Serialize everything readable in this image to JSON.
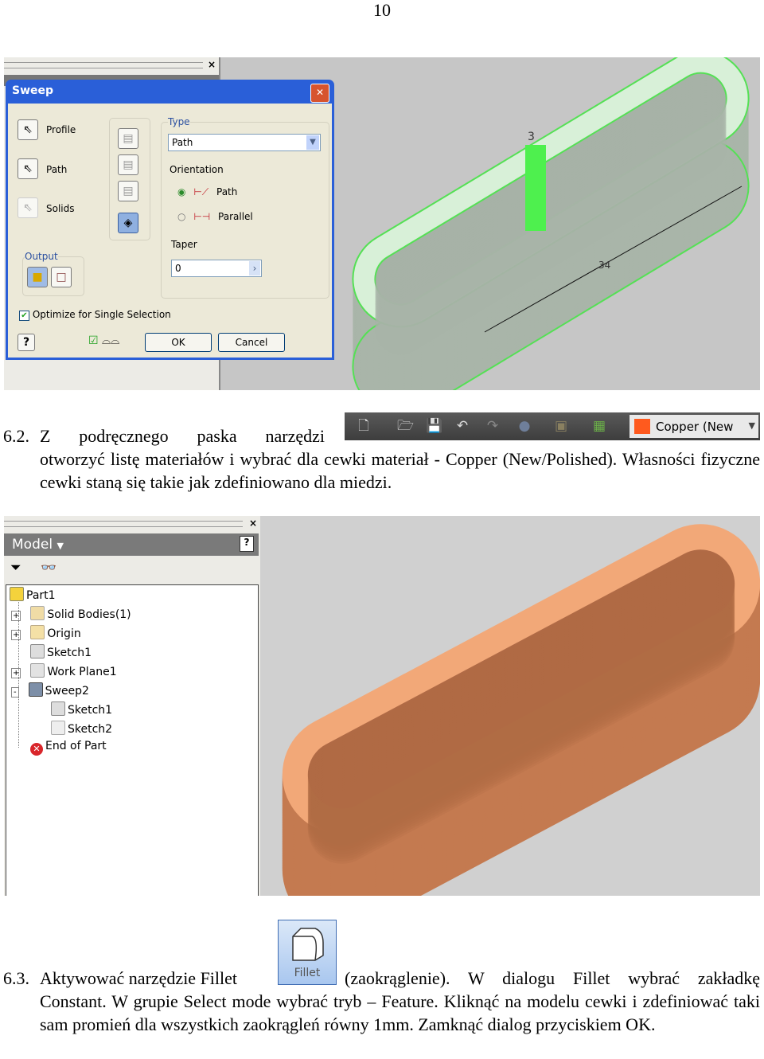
{
  "page_number": "10",
  "sweep_dialog": {
    "title": "Sweep",
    "profile_label": "Profile",
    "path_label": "Path",
    "solids_label": "Solids",
    "output_label": "Output",
    "type_label": "Type",
    "type_value": "Path",
    "orientation_label": "Orientation",
    "orientation_options": [
      {
        "label": "Path",
        "selected": true
      },
      {
        "label": "Parallel",
        "selected": false
      }
    ],
    "taper_label": "Taper",
    "taper_value": "0",
    "optimize_label": "Optimize for Single Selection",
    "optimize_checked": true,
    "ok_label": "OK",
    "cancel_label": "Cancel"
  },
  "viewport1": {
    "dim_height": "3",
    "dim_length": "34",
    "highlight_color": "#4ef04e"
  },
  "section_6_2": {
    "number": "6.2.",
    "line1": "Z podręcznego paska narzędzi",
    "rest": "otworzyć listę materiałów i wybrać dla cewki materiał - Copper (New/Polished). Własności fizyczne cewki staną się takie jak zdefiniowano dla miedzi."
  },
  "toolbar": {
    "material_value": "Copper (New",
    "material_color": "#ff5a1e"
  },
  "model_browser": {
    "title": "Model",
    "items": [
      {
        "label": "Part1",
        "icon": "part-icon"
      },
      {
        "label": "Solid Bodies(1)",
        "icon": "solid-bodies-icon",
        "expander": "+"
      },
      {
        "label": "Origin",
        "icon": "folder-icon",
        "expander": "+"
      },
      {
        "label": "Sketch1",
        "icon": "sketch-icon"
      },
      {
        "label": "Work Plane1",
        "icon": "work-plane-icon",
        "expander": "+"
      },
      {
        "label": "Sweep2",
        "icon": "sweep-icon",
        "expander": "-"
      },
      {
        "label": "Sketch1",
        "icon": "sketch-icon"
      },
      {
        "label": "Sketch2",
        "icon": "sketch-icon"
      },
      {
        "label": "End of Part",
        "icon": "end-of-part-icon"
      }
    ]
  },
  "viewport2": {
    "copper_top": "#f2a878",
    "copper_side": "#c47a50"
  },
  "section_6_3": {
    "number": "6.3.",
    "line1_before": "Aktywować narzędzie Fillet",
    "line1_after": "(zaokrąglenie). W dialogu  Fillet wybrać zakładkę",
    "rest": "Constant. W grupie Select mode wybrać tryb – Feature. Kliknąć na modelu cewki i zdefiniować taki sam promień dla wszystkich zaokrągleń równy 1mm. Zamknąć dialog przyciskiem OK.",
    "fillet_button_label": "Fillet"
  }
}
